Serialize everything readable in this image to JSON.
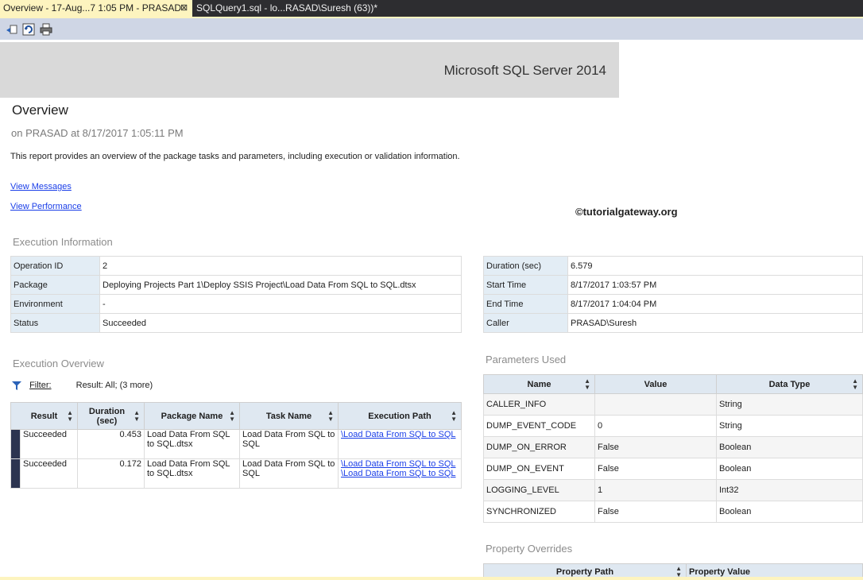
{
  "tabs": {
    "active": "Overview - 17-Aug...7 1:05 PM - PRASAD",
    "close": "⊠",
    "inactive": "SQLQuery1.sql - lo...RASAD\\Suresh (63))*"
  },
  "banner": {
    "title": "Microsoft SQL Server 2014"
  },
  "report": {
    "title": "Overview",
    "subtitle": "on PRASAD at 8/17/2017 1:05:11 PM",
    "description": "This report provides an overview of the package tasks and parameters, including execution or validation information.",
    "link_messages": "View Messages",
    "link_performance": "View Performance",
    "watermark": "©tutorialgateway.org"
  },
  "execution_info": {
    "heading": "Execution Information",
    "left": [
      {
        "k": "Operation ID",
        "v": "2"
      },
      {
        "k": "Package",
        "v": "Deploying Projects Part 1\\Deploy SSIS Project\\Load Data From SQL to SQL.dtsx"
      },
      {
        "k": "Environment",
        "v": "-"
      },
      {
        "k": "Status",
        "v": "Succeeded"
      }
    ],
    "right": [
      {
        "k": "Duration (sec)",
        "v": "6.579"
      },
      {
        "k": "Start Time",
        "v": "8/17/2017 1:03:57 PM"
      },
      {
        "k": "End Time",
        "v": "8/17/2017 1:04:04 PM"
      },
      {
        "k": "Caller",
        "v": "PRASAD\\Suresh"
      }
    ]
  },
  "execution_overview": {
    "heading": "Execution Overview",
    "filter_label": "Filter:",
    "filter_text": "Result: All;  (3 more)",
    "columns": [
      "Result",
      "Duration (sec)",
      "Package Name",
      "Task Name",
      "Execution Path"
    ],
    "rows": [
      {
        "result": "Succeeded",
        "duration": "0.453",
        "package": "Load Data From SQL to SQL.dtsx",
        "task": "Load Data From SQL to SQL",
        "path1": "\\Load Data From SQL to SQL",
        "path2": ""
      },
      {
        "result": "Succeeded",
        "duration": "0.172",
        "package": "Load Data From SQL to SQL.dtsx",
        "task": "Load Data From SQL to SQL",
        "path1": "\\Load Data From SQL to SQL",
        "path2": "\\Load Data From SQL to SQL"
      }
    ]
  },
  "parameters": {
    "heading": "Parameters Used",
    "columns": [
      "Name",
      "Value",
      "Data Type"
    ],
    "rows": [
      {
        "name": "CALLER_INFO",
        "value": "",
        "type": "String"
      },
      {
        "name": "DUMP_EVENT_CODE",
        "value": "0",
        "type": "String"
      },
      {
        "name": "DUMP_ON_ERROR",
        "value": "False",
        "type": "Boolean"
      },
      {
        "name": "DUMP_ON_EVENT",
        "value": "False",
        "type": "Boolean"
      },
      {
        "name": "LOGGING_LEVEL",
        "value": "1",
        "type": "Int32"
      },
      {
        "name": "SYNCHRONIZED",
        "value": "False",
        "type": "Boolean"
      }
    ]
  },
  "overrides": {
    "heading": "Property Overrides",
    "columns": [
      "Property Path",
      "Property Value"
    ]
  },
  "colors": {
    "tab_accent": "#fdf4bf",
    "link": "#1a3ee8",
    "header_bg": "#dfe8f1",
    "key_bg": "#e3edf5"
  }
}
